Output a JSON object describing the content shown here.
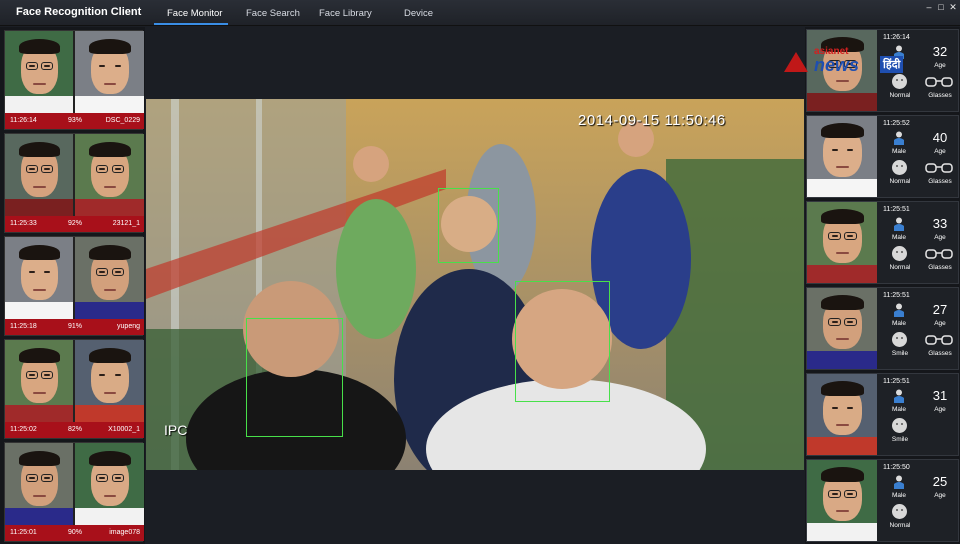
{
  "app": {
    "title": "Face Recognition Client",
    "tabs": [
      "Face Monitor",
      "Face Search",
      "Face Library",
      "Device"
    ],
    "active_tab": "Face Monitor"
  },
  "video": {
    "timestamp": "2014-09-15  11:50:46",
    "channel": "IPC"
  },
  "matches": [
    {
      "time": "11:26:14",
      "score": "93%",
      "id": "DSC_0229"
    },
    {
      "time": "11:25:33",
      "score": "92%",
      "id": "23121_1"
    },
    {
      "time": "11:25:18",
      "score": "91%",
      "id": "yupeng"
    },
    {
      "time": "11:25:02",
      "score": "82%",
      "id": "X10002_1"
    },
    {
      "time": "11:25:01",
      "score": "90%",
      "id": "image078"
    }
  ],
  "attributes": [
    {
      "time": "11:26:14",
      "gender": "",
      "age": "32",
      "age_label": "Age",
      "expression": "Normal",
      "glasses": "Glasses"
    },
    {
      "time": "11:25:52",
      "gender": "Male",
      "age": "40",
      "age_label": "Age",
      "expression": "Normal",
      "glasses": "Glasses"
    },
    {
      "time": "11:25:51",
      "gender": "Male",
      "age": "33",
      "age_label": "Age",
      "expression": "Normal",
      "glasses": "Glasses"
    },
    {
      "time": "11:25:51",
      "gender": "Male",
      "age": "27",
      "age_label": "Age",
      "expression": "Smile",
      "glasses": "Glasses"
    },
    {
      "time": "11:25:51",
      "gender": "Male",
      "age": "31",
      "age_label": "Age",
      "expression": "Smile",
      "glasses": ""
    },
    {
      "time": "11:25:50",
      "gender": "Male",
      "age": "25",
      "age_label": "Age",
      "expression": "Normal",
      "glasses": ""
    }
  ],
  "watermark": {
    "line1": "asianet",
    "line2": "news",
    "line3": "हिंदी"
  },
  "colors": {
    "accent": "#3a8ee6",
    "match_bar": "#a8101a",
    "detection_box": "#48e04a"
  }
}
